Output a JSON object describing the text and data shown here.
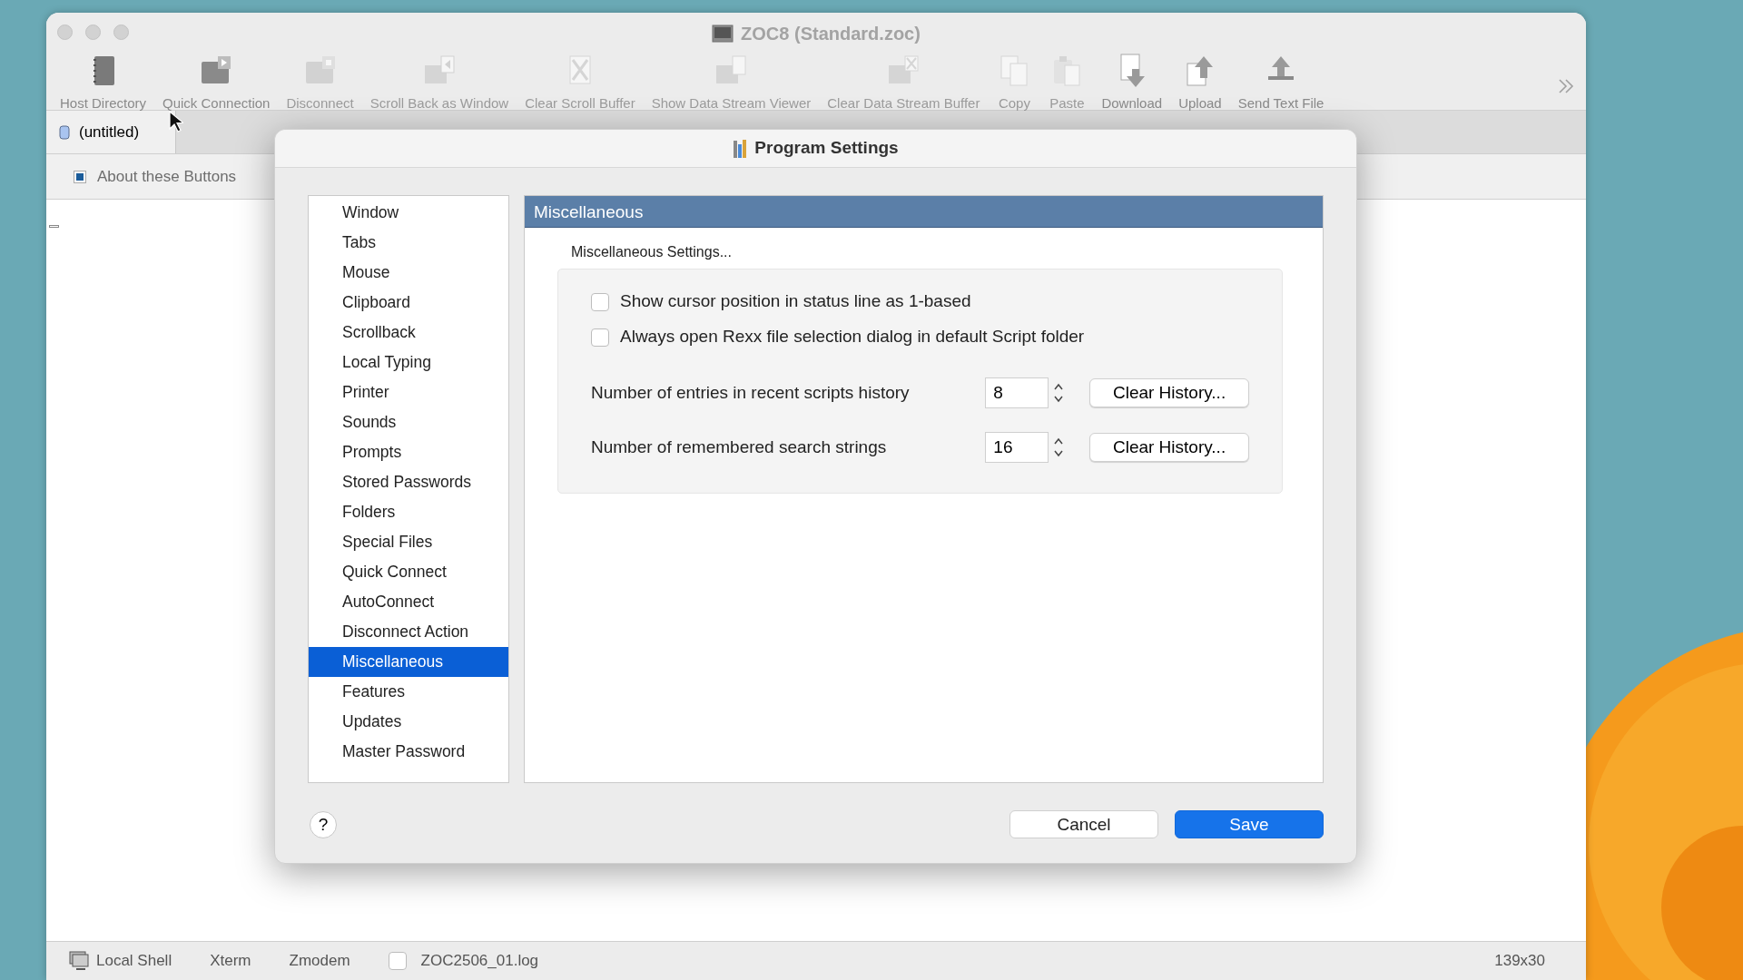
{
  "window": {
    "title": "ZOC8 (Standard.zoc)"
  },
  "toolbar": [
    {
      "label": "Host Directory",
      "disabled": false
    },
    {
      "label": "Quick Connection",
      "disabled": false
    },
    {
      "label": "Disconnect",
      "disabled": true
    },
    {
      "label": "Scroll Back as Window",
      "disabled": true
    },
    {
      "label": "Clear Scroll Buffer",
      "disabled": true
    },
    {
      "label": "Show Data Stream Viewer",
      "disabled": true
    },
    {
      "label": "Clear Data Stream Buffer",
      "disabled": true
    },
    {
      "label": "Copy",
      "disabled": true
    },
    {
      "label": "Paste",
      "disabled": true
    },
    {
      "label": "Download",
      "disabled": false
    },
    {
      "label": "Upload",
      "disabled": false
    },
    {
      "label": "Send Text File",
      "disabled": false
    }
  ],
  "tabs": [
    {
      "label": "(untitled)",
      "selected": true
    }
  ],
  "button_bar": [
    {
      "label": "About these Buttons"
    }
  ],
  "dialog": {
    "title": "Program Settings",
    "sidebar": [
      {
        "label": "Window",
        "selected": false
      },
      {
        "label": "Tabs",
        "selected": false
      },
      {
        "label": "Mouse",
        "selected": false
      },
      {
        "label": "Clipboard",
        "selected": false
      },
      {
        "label": "Scrollback",
        "selected": false
      },
      {
        "label": "Local Typing",
        "selected": false
      },
      {
        "label": "Printer",
        "selected": false
      },
      {
        "label": "Sounds",
        "selected": false
      },
      {
        "label": "Prompts",
        "selected": false
      },
      {
        "label": "Stored Passwords",
        "selected": false
      },
      {
        "label": "Folders",
        "selected": false
      },
      {
        "label": "Special Files",
        "selected": false
      },
      {
        "label": "Quick Connect",
        "selected": false
      },
      {
        "label": "AutoConnect",
        "selected": false
      },
      {
        "label": "Disconnect Action",
        "selected": false
      },
      {
        "label": "Miscellaneous",
        "selected": true
      },
      {
        "label": "Features",
        "selected": false
      },
      {
        "label": "Updates",
        "selected": false
      },
      {
        "label": "Master Password",
        "selected": false
      }
    ],
    "panel_title": "Miscellaneous",
    "group_label": "Miscellaneous Settings...",
    "checkboxes": [
      {
        "label": "Show cursor position in status line as 1-based",
        "checked": false
      },
      {
        "label": "Always open Rexx file selection dialog in default Script folder",
        "checked": false
      }
    ],
    "number_rows": [
      {
        "label": "Number of entries in recent scripts history",
        "value": "8",
        "button": "Clear History..."
      },
      {
        "label": "Number of remembered search strings",
        "value": "16",
        "button": "Clear History..."
      }
    ],
    "help": "?",
    "buttons": [
      {
        "label": "Cancel",
        "kind": "secondary"
      },
      {
        "label": "Save",
        "kind": "primary"
      }
    ]
  },
  "status_bar": {
    "items": [
      "Local Shell",
      "Xterm",
      "Zmodem"
    ],
    "log": {
      "label": "ZOC2506_01.log",
      "checked": false
    },
    "size": "139x30"
  }
}
